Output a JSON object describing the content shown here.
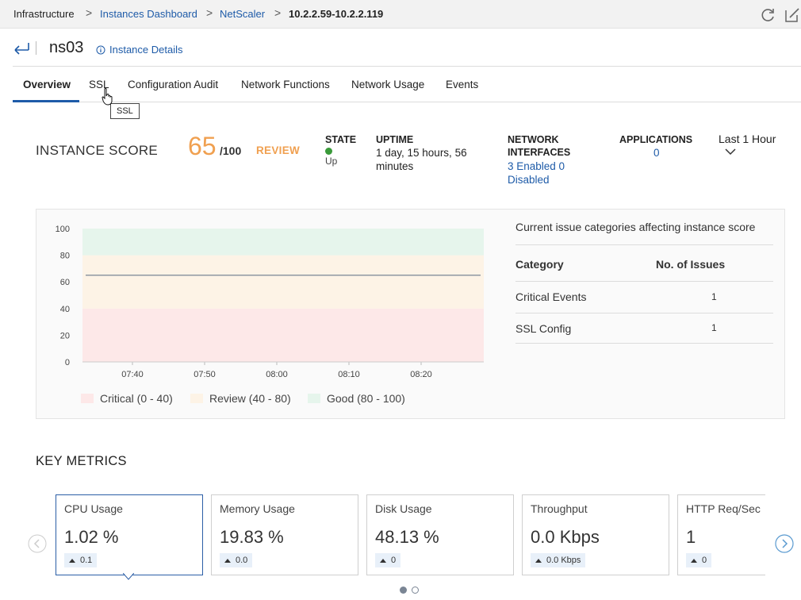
{
  "breadcrumb": {
    "items": [
      "Infrastructure",
      "Instances Dashboard",
      "NetScaler",
      "10.2.2.59-10.2.2.119"
    ],
    "separator": ">"
  },
  "toolbar": {
    "refresh_icon": "refresh-icon",
    "edit_icon": "edit-icon"
  },
  "header": {
    "title": "ns03",
    "details_link": "Instance Details"
  },
  "tabs": [
    "Overview",
    "SSL",
    "Configuration Audit",
    "Network Functions",
    "Network Usage",
    "Events"
  ],
  "tooltip": "SSL",
  "score": {
    "label": "INSTANCE SCORE",
    "value": "65",
    "max": "/100",
    "status": "REVIEW",
    "color": "#f0a050"
  },
  "stats": {
    "state_label": "STATE",
    "state_value": "Up",
    "uptime_label": "UPTIME",
    "uptime_value": "1 day, 15 hours, 56 minutes",
    "net_label": "NETWORK INTERFACES",
    "net_value": "3 Enabled 0 Disabled",
    "apps_label": "APPLICATIONS",
    "apps_value": "0",
    "period": "Last 1 Hour"
  },
  "chart_data": {
    "type": "line",
    "x": [
      "07:40",
      "07:50",
      "08:00",
      "08:10",
      "08:20"
    ],
    "yticks": [
      0,
      20,
      40,
      60,
      80,
      100
    ],
    "ylim": [
      0,
      100
    ],
    "series": [
      {
        "values": [
          65,
          65,
          65,
          65,
          65,
          65
        ]
      }
    ],
    "bands": [
      {
        "name": "Critical (0 - 40)",
        "from": 0,
        "to": 40,
        "color": "#fde8e8"
      },
      {
        "name": "Review (40 - 80)",
        "from": 40,
        "to": 80,
        "color": "#fdf3e6"
      },
      {
        "name": "Good (80 - 100)",
        "from": 80,
        "to": 100,
        "color": "#e6f5ec"
      }
    ],
    "line_color": "#6a7a8c"
  },
  "issues": {
    "title": "Current issue categories affecting instance score",
    "col_category": "Category",
    "col_count": "No. of Issues",
    "rows": [
      {
        "category": "Critical Events",
        "count": "1"
      },
      {
        "category": "SSL Config",
        "count": "1"
      }
    ]
  },
  "metrics": {
    "title": "KEY METRICS",
    "cards": [
      {
        "label": "CPU Usage",
        "value": "1.02 %",
        "delta": "0.1"
      },
      {
        "label": "Memory Usage",
        "value": "19.83 %",
        "delta": "0.0"
      },
      {
        "label": "Disk Usage",
        "value": "48.13 %",
        "delta": "0"
      },
      {
        "label": "Throughput",
        "value": "0.0 Kbps",
        "delta": "0.0 Kbps"
      },
      {
        "label": "HTTP Req/Sec",
        "value": "1",
        "delta": "0"
      }
    ]
  }
}
